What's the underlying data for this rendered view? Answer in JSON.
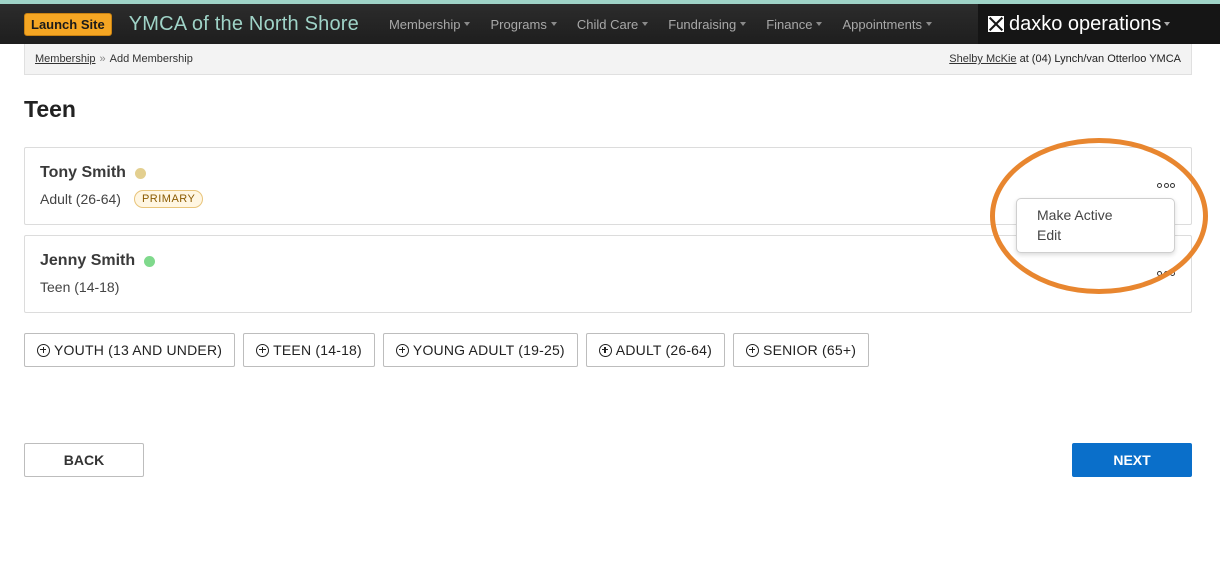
{
  "header": {
    "launch_label": "Launch Site",
    "org_title": "YMCA of the North Shore",
    "nav": [
      {
        "label": "Membership"
      },
      {
        "label": "Programs"
      },
      {
        "label": "Child Care"
      },
      {
        "label": "Fundraising"
      },
      {
        "label": "Finance"
      },
      {
        "label": "Appointments"
      }
    ],
    "brand": "daxko operations"
  },
  "breadcrumb": {
    "parent": "Membership",
    "separator": "»",
    "current": "Add Membership",
    "user": "Shelby McKie",
    "location": "at (04) Lynch/van Otterloo YMCA"
  },
  "page": {
    "title": "Teen"
  },
  "members": [
    {
      "name": "Tony Smith",
      "status_color": "#e3cf8f",
      "category": "Adult (26-64)",
      "badge": "PRIMARY"
    },
    {
      "name": "Jenny Smith",
      "status_color": "#7fd98c",
      "category": "Teen (14-18)",
      "badge": ""
    }
  ],
  "menu": {
    "items": [
      "Make Active",
      "Edit"
    ]
  },
  "categories": [
    "YOUTH (13 AND UNDER)",
    "TEEN (14-18)",
    "YOUNG ADULT (19-25)",
    "ADULT (26-64)",
    "SENIOR (65+)"
  ],
  "footer": {
    "back_label": "BACK",
    "next_label": "NEXT"
  },
  "colors": {
    "accent": "#0a6fca",
    "launch": "#f5a623",
    "title": "#9fd3c7",
    "highlight": "#e8862f"
  }
}
